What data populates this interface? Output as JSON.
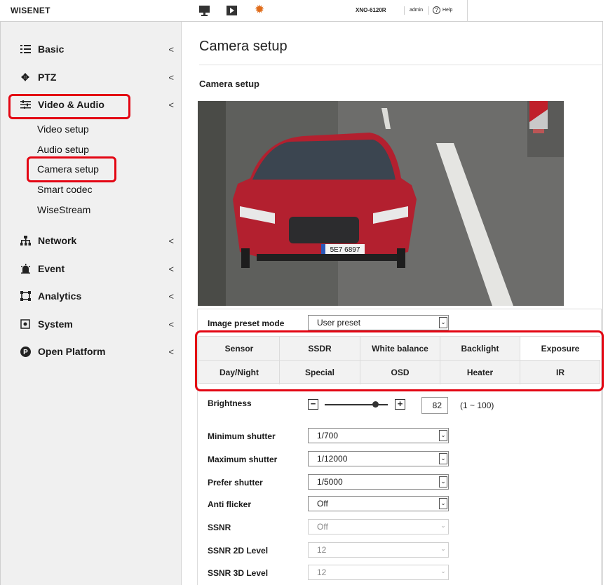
{
  "header": {
    "logo": "WISENET",
    "icons": [
      "monitor-icon",
      "play-icon",
      "gear-icon"
    ],
    "model": "XNO-6120R",
    "user": "admin",
    "help_label": "Help"
  },
  "sidebar": {
    "items": [
      {
        "label": "Basic",
        "icon": "list-icon"
      },
      {
        "label": "PTZ",
        "icon": "move-icon"
      },
      {
        "label": "Video & Audio",
        "icon": "sliders-icon"
      },
      {
        "label": "Network",
        "icon": "network-icon"
      },
      {
        "label": "Event",
        "icon": "alarm-icon"
      },
      {
        "label": "Analytics",
        "icon": "analytics-icon"
      },
      {
        "label": "System",
        "icon": "system-icon"
      },
      {
        "label": "Open Platform",
        "icon": "open-platform-icon"
      }
    ],
    "chevron": "<",
    "sub_items": [
      "Video setup",
      "Audio setup",
      "Camera setup",
      "Smart codec",
      "WiseStream"
    ]
  },
  "main": {
    "page_title": "Camera setup",
    "section_title": "Camera setup",
    "preview": {
      "plate": "5E7 6897"
    },
    "image_preset": {
      "label": "Image preset mode",
      "value": "User preset"
    },
    "tabs": {
      "row1": [
        "Sensor",
        "SSDR",
        "White balance",
        "Backlight",
        "Exposure"
      ],
      "row2": [
        "Day/Night",
        "Special",
        "OSD",
        "Heater",
        "IR"
      ],
      "active": "Exposure"
    },
    "brightness": {
      "label": "Brightness",
      "value": "82",
      "fraction": 0.82,
      "range": "(1 ~ 100)",
      "minus": "−",
      "plus": "+"
    },
    "fields": [
      {
        "label": "Minimum shutter",
        "value": "1/700",
        "disabled": false
      },
      {
        "label": "Maximum shutter",
        "value": "1/12000",
        "disabled": false
      },
      {
        "label": "Prefer shutter",
        "value": "1/5000",
        "disabled": false
      },
      {
        "label": "Anti flicker",
        "value": "Off",
        "disabled": false
      },
      {
        "label": "SSNR",
        "value": "Off",
        "disabled": true
      },
      {
        "label": "SSNR 2D Level",
        "value": "12",
        "disabled": true
      },
      {
        "label": "SSNR 3D Level",
        "value": "12",
        "disabled": true
      }
    ],
    "dropdown_arrow": "⌄"
  },
  "colors": {
    "highlight": "#e30613",
    "gear": "#e06c1a",
    "car": "#b3202f"
  }
}
